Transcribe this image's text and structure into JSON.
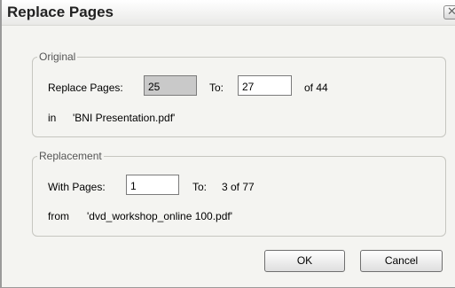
{
  "dialog": {
    "title": "Replace Pages",
    "close_glyph": "✕"
  },
  "original": {
    "legend": "Original",
    "replace_label": "Replace Pages:",
    "from_value": "25",
    "to_label": "To:",
    "to_value": "27",
    "of_text": "of 44",
    "in_label": "in",
    "file_name": "'BNI Presentation.pdf'"
  },
  "replacement": {
    "legend": "Replacement",
    "with_label": "With Pages:",
    "from_value": "1",
    "to_label": "To:",
    "to_text": "3 of 77",
    "from_label": "from",
    "file_name": "'dvd_workshop_online 100.pdf'"
  },
  "buttons": {
    "ok": "OK",
    "cancel": "Cancel"
  }
}
